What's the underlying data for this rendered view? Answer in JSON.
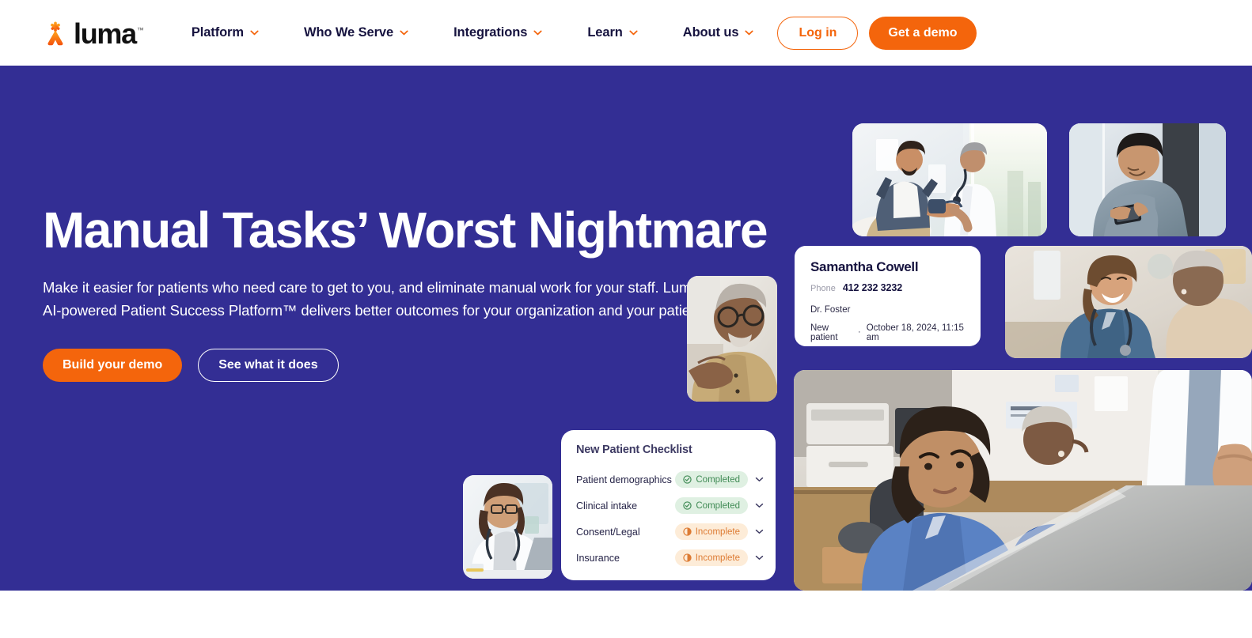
{
  "brand": {
    "name": "luma",
    "trademark": "™",
    "logo_icon": "luma-asterisk-icon",
    "mark_color": "#f4650c"
  },
  "nav": {
    "items": [
      {
        "label": "Platform",
        "chevron": "chevron-down-icon"
      },
      {
        "label": "Who We Serve",
        "chevron": "chevron-down-icon"
      },
      {
        "label": "Integrations",
        "chevron": "chevron-down-icon"
      },
      {
        "label": "Learn",
        "chevron": "chevron-down-icon"
      },
      {
        "label": "About us",
        "chevron": "chevron-down-icon"
      }
    ],
    "login_label": "Log in",
    "demo_label": "Get a demo"
  },
  "hero": {
    "title": "Manual Tasks’ Worst Nightmare",
    "subtitle": "Make it easier for patients who need care to get to you, and eliminate manual work for your staff. Luma's AI-powered Patient Success Platform™ delivers better outcomes for your organization and your patients.",
    "primary_cta": "Build your demo",
    "secondary_cta": "See what it does",
    "background_color": "#332e94"
  },
  "patient_card": {
    "name": "Samantha Cowell",
    "phone_label": "Phone",
    "phone_value": "412 232 3232",
    "doctor": "Dr. Foster",
    "status": "New patient",
    "separator": "·",
    "appointment": "October 18, 2024, 11:15 am"
  },
  "checklist_card": {
    "title": "New Patient Checklist",
    "rows": [
      {
        "label": "Patient demographics",
        "status": "Completed",
        "state": "completed",
        "status_icon": "check-circle-icon",
        "chevron": "chevron-down-icon"
      },
      {
        "label": "Clinical intake",
        "status": "Completed",
        "state": "completed",
        "status_icon": "check-circle-icon",
        "chevron": "chevron-down-icon"
      },
      {
        "label": "Consent/Legal",
        "status": "Incomplete",
        "state": "incomplete",
        "status_icon": "half-circle-icon",
        "chevron": "chevron-down-icon"
      },
      {
        "label": "Insurance",
        "status": "Incomplete",
        "state": "incomplete",
        "status_icon": "half-circle-icon",
        "chevron": "chevron-down-icon"
      }
    ],
    "completed_color": "#3f8a54",
    "completed_bg": "#dff0e2",
    "incomplete_color": "#dd7b33",
    "incomplete_bg": "#fdecd8"
  },
  "collage": {
    "photos": [
      {
        "id": "exam",
        "alt": "Doctor checking patient blood pressure in bright clinic room"
      },
      {
        "id": "phone",
        "alt": "Man in blue-gray sweater looking at his smartphone"
      },
      {
        "id": "nurse",
        "alt": "Smiling nurse in blue scrubs with stethoscope talking with elderly patient"
      },
      {
        "id": "senior",
        "alt": "Elderly man with glasses in tan shirt using a mobile phone"
      },
      {
        "id": "laptop",
        "alt": "Female doctor in white coat with stethoscope working on a laptop"
      },
      {
        "id": "frontdesk",
        "alt": "Medical receptionist in blue scrubs at front desk with patients waiting"
      }
    ]
  },
  "colors": {
    "brand_orange": "#f4650c",
    "hero_indigo": "#332e94",
    "nav_text": "#16133f",
    "white": "#ffffff"
  }
}
